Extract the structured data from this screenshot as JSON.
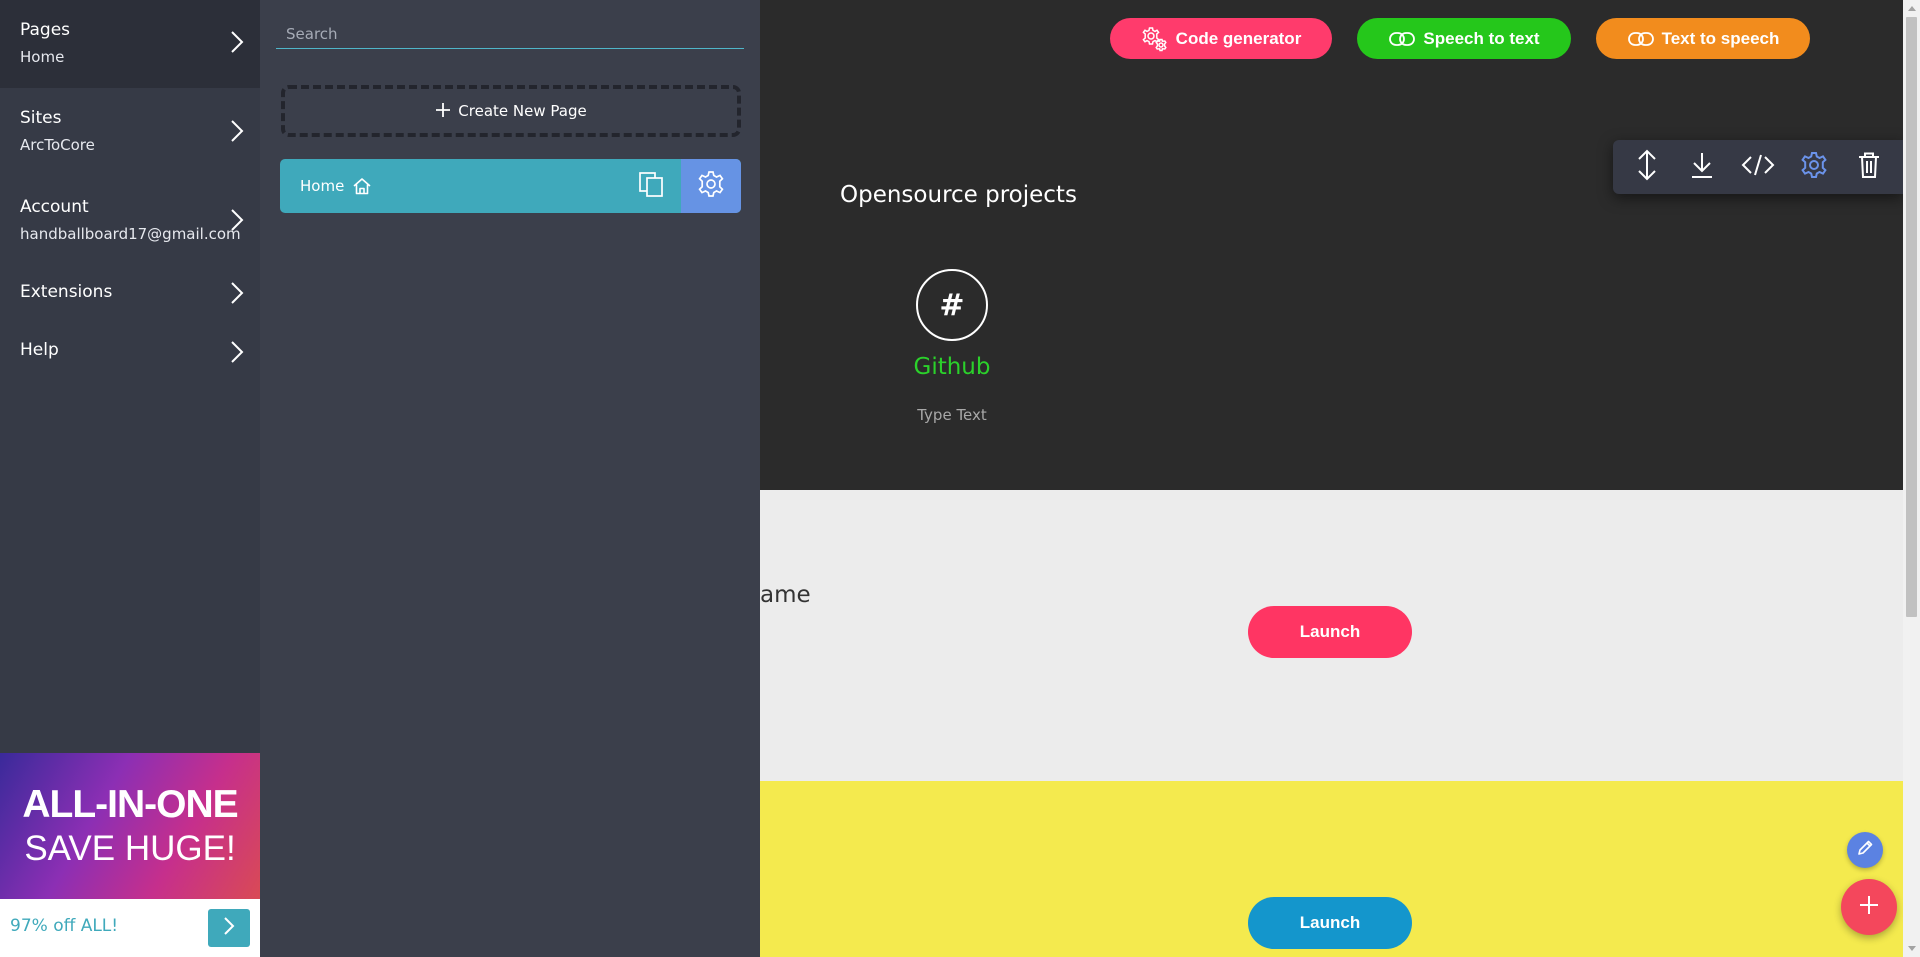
{
  "nav": {
    "items": [
      {
        "title": "Pages",
        "subtitle": "Home"
      },
      {
        "title": "Sites",
        "subtitle": "ArcToCore"
      },
      {
        "title": "Account",
        "subtitle": "handballboard17@gmail.com"
      },
      {
        "title": "Extensions"
      },
      {
        "title": "Help"
      }
    ],
    "ad": {
      "line1": "ALL-IN-ONE",
      "line2": "SAVE HUGE!",
      "offer": "97% off ALL!"
    }
  },
  "pages_panel": {
    "search_placeholder": "Search",
    "create_label": "Create New Page",
    "pages": [
      {
        "name": "Home"
      }
    ]
  },
  "canvas": {
    "header_buttons": {
      "code": "Code generator",
      "stt": "Speech to text",
      "tts": "Text to speech"
    },
    "section_title": "Opensource projects",
    "card": {
      "icon_text": "#",
      "title": "Github",
      "text": "Type Text"
    },
    "partial_heading": "ame",
    "launch_1": "Launch",
    "launch_2": "Launch"
  },
  "colors": {
    "accent_teal": "#3fa9bb",
    "settings_blue": "#6693e4",
    "code_pink": "#ff3b6c",
    "stt_green": "#25c71b",
    "tts_orange": "#f28c1d",
    "github_green": "#2bd12b",
    "launch_pink": "#ff3563",
    "launch_blue": "#1496cc",
    "yellow_section": "#f4ea4e"
  },
  "icons": [
    "chevron-right-icon",
    "plus-icon",
    "home-icon",
    "copy-icon",
    "gear-icon",
    "link-icon",
    "resize-vertical-icon",
    "download-icon",
    "code-icon",
    "trash-icon",
    "pencil-icon"
  ]
}
